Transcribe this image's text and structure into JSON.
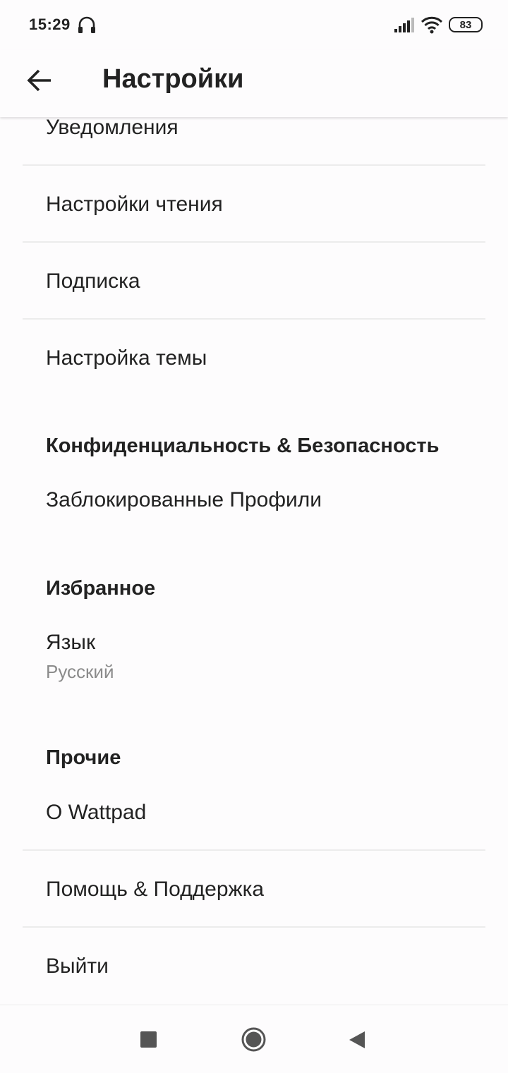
{
  "status_bar": {
    "time": "15:29",
    "battery_level": "83",
    "icons": [
      "headphone-icon",
      "signal-icon",
      "wifi-icon",
      "battery-icon"
    ]
  },
  "toolbar": {
    "back_icon": "arrow-left-icon",
    "title": "Настройки"
  },
  "settings": {
    "items": [
      {
        "label": "Уведомления"
      },
      {
        "label": "Настройки чтения"
      },
      {
        "label": "Подписка"
      },
      {
        "label": "Настройка темы"
      }
    ],
    "privacy": {
      "header": "Конфиденциальность & Безопасность",
      "items": [
        {
          "label": "Заблокированные Профили"
        }
      ]
    },
    "preferences": {
      "header": "Избранное",
      "items": [
        {
          "label": "Язык",
          "value": "Русский"
        }
      ]
    },
    "other": {
      "header": "Прочие",
      "items": [
        {
          "label": "О Wattpad"
        },
        {
          "label": "Помощь & Поддержка"
        },
        {
          "label": "Выйти"
        }
      ]
    }
  },
  "nav_bar": {
    "icons": [
      "recent-apps-icon",
      "home-icon",
      "back-triangle-icon"
    ]
  },
  "colors": {
    "background": "#fdfcfd",
    "text": "#222222",
    "secondary_text": "#8b8b8b",
    "divider": "#ececec"
  }
}
